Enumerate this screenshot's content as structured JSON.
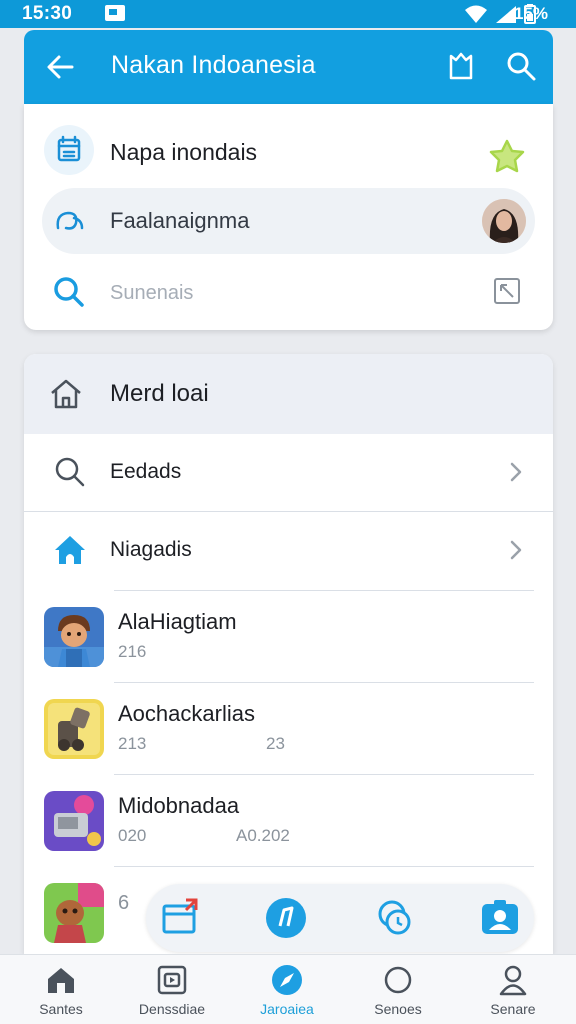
{
  "status_bar": {
    "time": "15:30",
    "battery": "15%"
  },
  "app_bar": {
    "title": "Nakan Indoanesia"
  },
  "top_card": {
    "row1_label": "Napa inondais",
    "row2_label": "Faalanaignma",
    "search_placeholder": "Sunenais"
  },
  "section": {
    "title": "Merd loai",
    "nav_items": [
      {
        "label": "Eedads"
      },
      {
        "label": "Niagadis"
      }
    ]
  },
  "apps": [
    {
      "name": "AlaHiagtiam",
      "meta1": "216",
      "meta2": ""
    },
    {
      "name": "Aochackarlias",
      "meta1": "213",
      "meta2": "23"
    },
    {
      "name": "Midobnadaa",
      "meta1": "020",
      "meta2": "A0.202"
    },
    {
      "name": "",
      "meta1": "6",
      "meta2": ""
    }
  ],
  "bottom_nav": {
    "tabs": [
      {
        "label": "Santes",
        "icon": "home-icon"
      },
      {
        "label": "Denssdiae",
        "icon": "media-icon"
      },
      {
        "label": "Jaroaiea",
        "icon": "compass-icon"
      },
      {
        "label": "Senoes",
        "icon": "circle-icon"
      },
      {
        "label": "Senare",
        "icon": "person-icon"
      }
    ],
    "active_index": 2
  },
  "colors": {
    "primary": "#129fe0",
    "status_bar": "#0d99d8",
    "star": "#a8d64a",
    "active_tab": "#1e9fd8"
  }
}
